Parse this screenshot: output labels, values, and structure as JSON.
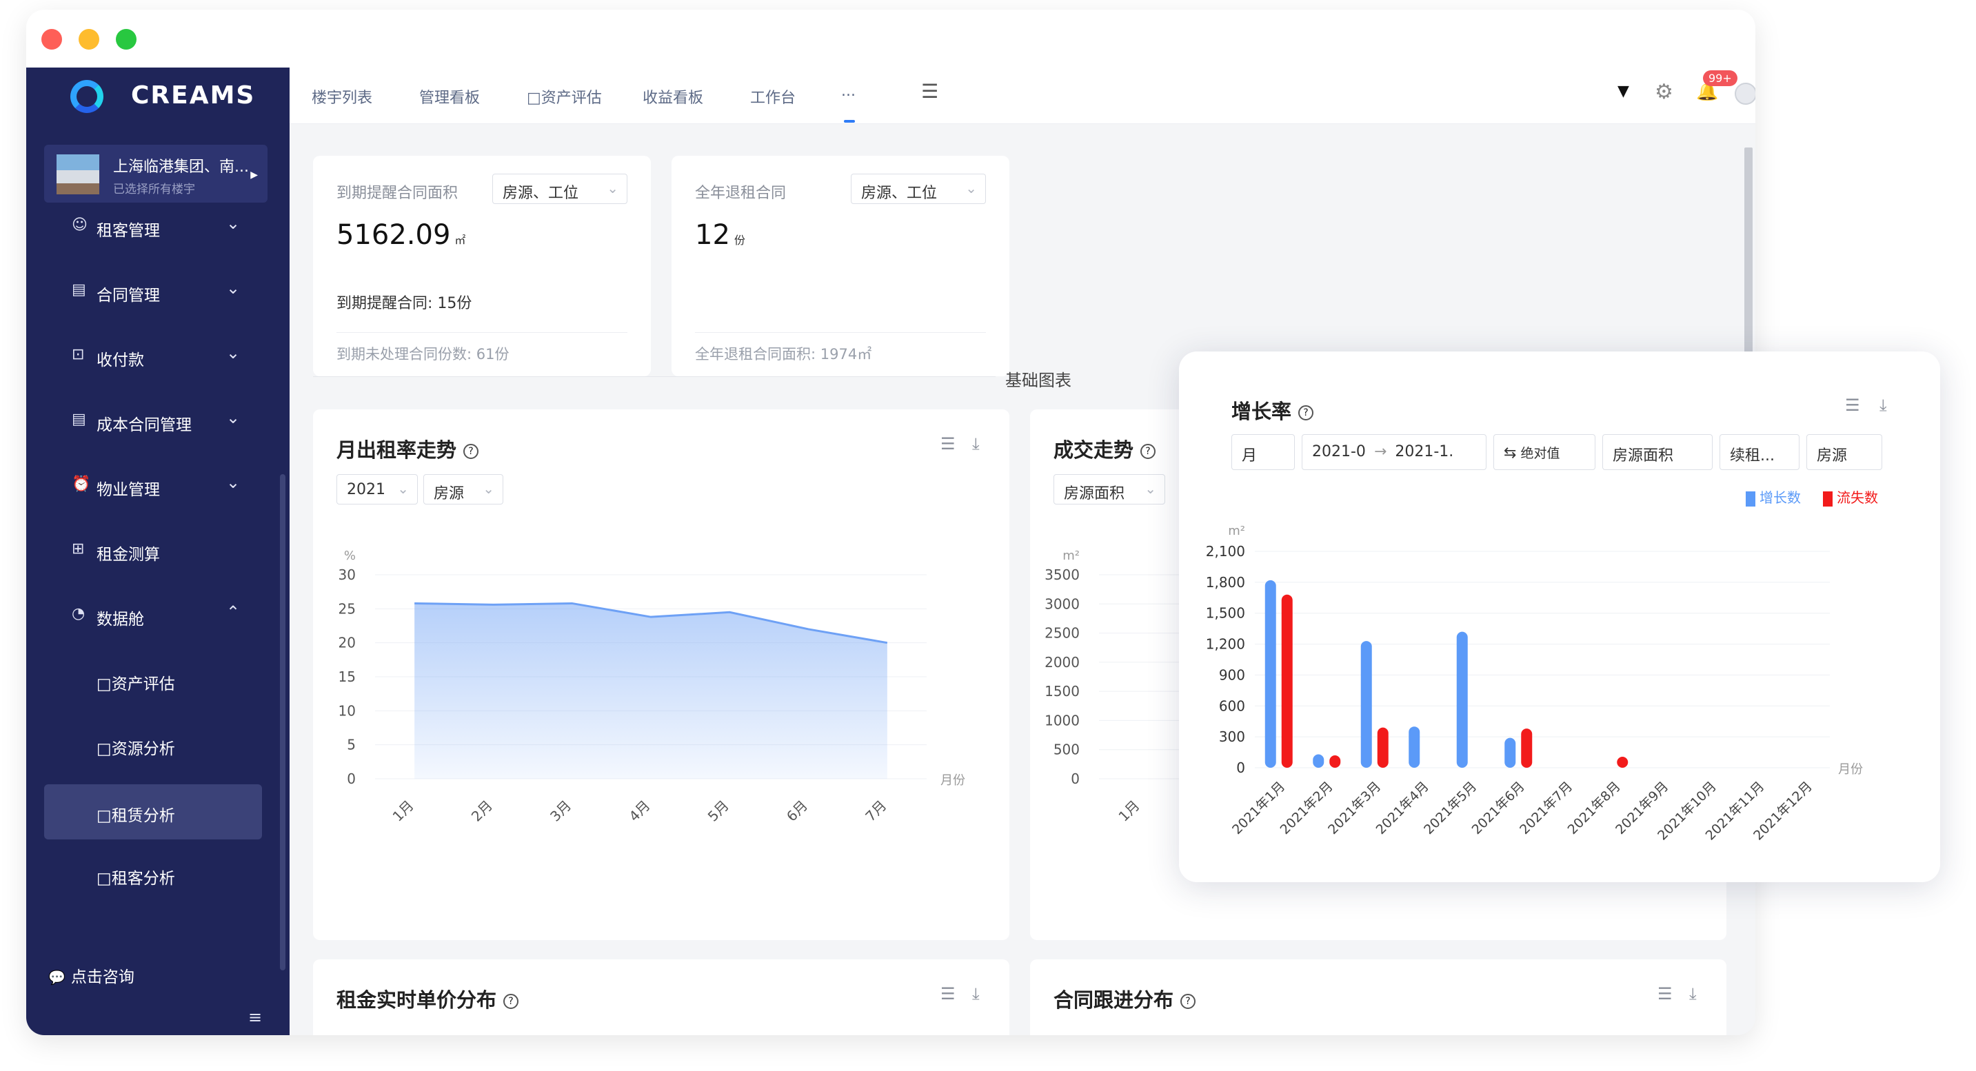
{
  "window": {
    "traffic": [
      "#fe5f57",
      "#febc2e",
      "#28c840"
    ]
  },
  "sidebar": {
    "brand": "CREAMS",
    "project": {
      "name": "上海临港集团、南...",
      "subtitle": "已选择所有楼宇"
    },
    "items": [
      {
        "label": "租客管理",
        "icon": "person-icon",
        "chevron": "⌄"
      },
      {
        "label": "合同管理",
        "icon": "doc-icon",
        "chevron": "⌄"
      },
      {
        "label": "收付款",
        "icon": "payment-icon",
        "chevron": "⌄"
      },
      {
        "label": "成本合同管理",
        "icon": "doc-icon",
        "chevron": "⌄"
      },
      {
        "label": "物业管理",
        "icon": "alarm-icon",
        "chevron": "⌄"
      },
      {
        "label": "租金测算",
        "icon": "calculator-icon",
        "chevron": ""
      },
      {
        "label": "数据舱",
        "icon": "dashboard-icon",
        "chevron": "⌃"
      }
    ],
    "subitems": [
      {
        "label": "□资产评估"
      },
      {
        "label": "□资源分析"
      },
      {
        "label": "□租赁分析"
      },
      {
        "label": "□租客分析"
      }
    ],
    "consult": "点击咨询"
  },
  "topnav": {
    "tabs": [
      "楼宇列表",
      "管理看板",
      "□资产评估",
      "收益看板",
      "工作台",
      "..."
    ],
    "badge": "99+"
  },
  "kpi": [
    {
      "label": "到期提醒合同面积",
      "select": "房源、工位",
      "value": "5162.09",
      "unit": "㎡",
      "metric": "到期提醒合同: 15份",
      "footer": "到期未处理合同份数: 61份"
    },
    {
      "label": "全年退租合同",
      "select": "房源、工位",
      "value": "12",
      "unit": "份",
      "metric": "",
      "footer": "全年退租合同面积: 1974㎡"
    }
  ],
  "section_title": "基础图表",
  "cards": {
    "monthly": {
      "title": "月出租率走势",
      "filters": [
        "2021",
        "房源"
      ]
    },
    "deal": {
      "title": "成交走势",
      "filters": [
        "房源面积"
      ]
    },
    "rent": {
      "title": "租金实时单价分布"
    },
    "contract": {
      "title": "合同跟进分布"
    }
  },
  "chart_data": [
    {
      "type": "area",
      "title": "月出租率走势",
      "ylabel": "%",
      "xlabel": "月份",
      "categories": [
        "1月",
        "2月",
        "3月",
        "4月",
        "5月",
        "6月",
        "7月"
      ],
      "series": [
        {
          "values": [
            25.8,
            25.6,
            25.8,
            23.8,
            24.5,
            22.0,
            20.0
          ]
        }
      ],
      "ylim": [
        0,
        30
      ],
      "yticks": [
        0,
        5,
        10,
        15,
        20,
        25,
        30
      ],
      "grid": true,
      "color": "#6ea1f5"
    },
    {
      "type": "line",
      "title": "成交走势",
      "ylabel": "m²",
      "categories": [
        "1月"
      ],
      "ylim": [
        0,
        3500
      ],
      "yticks": [
        0,
        500,
        1000,
        1500,
        2000,
        2500,
        3000,
        3500
      ],
      "grid": true
    },
    {
      "type": "bar",
      "title": "增长率",
      "ylabel": "m²",
      "xlabel": "月份",
      "categories": [
        "2021年1月",
        "2021年2月",
        "2021年3月",
        "2021年4月",
        "2021年5月",
        "2021年6月",
        "2021年7月",
        "2021年8月",
        "2021年9月",
        "2021年10月",
        "2021年11月",
        "2021年12月"
      ],
      "series": [
        {
          "name": "增长数",
          "color": "#5b9af8",
          "values": [
            1820,
            130,
            1230,
            400,
            1320,
            290,
            0,
            0,
            0,
            0,
            0,
            0
          ]
        },
        {
          "name": "流失数",
          "color": "#f21b1b",
          "values": [
            1680,
            120,
            390,
            0,
            0,
            380,
            0,
            60,
            0,
            0,
            0,
            0
          ]
        }
      ],
      "ylim": [
        0,
        2100
      ],
      "yticks": [
        0,
        300,
        600,
        900,
        1200,
        1500,
        1800,
        2100
      ],
      "grid": true,
      "legend": "top-right"
    }
  ],
  "float": {
    "title": "增长率",
    "filters": {
      "period": "月",
      "range_start": "2021-0",
      "range_end": "2021-1.",
      "mode": "绝对值",
      "metric": "房源面积",
      "type": "续租...",
      "source": "房源"
    }
  }
}
